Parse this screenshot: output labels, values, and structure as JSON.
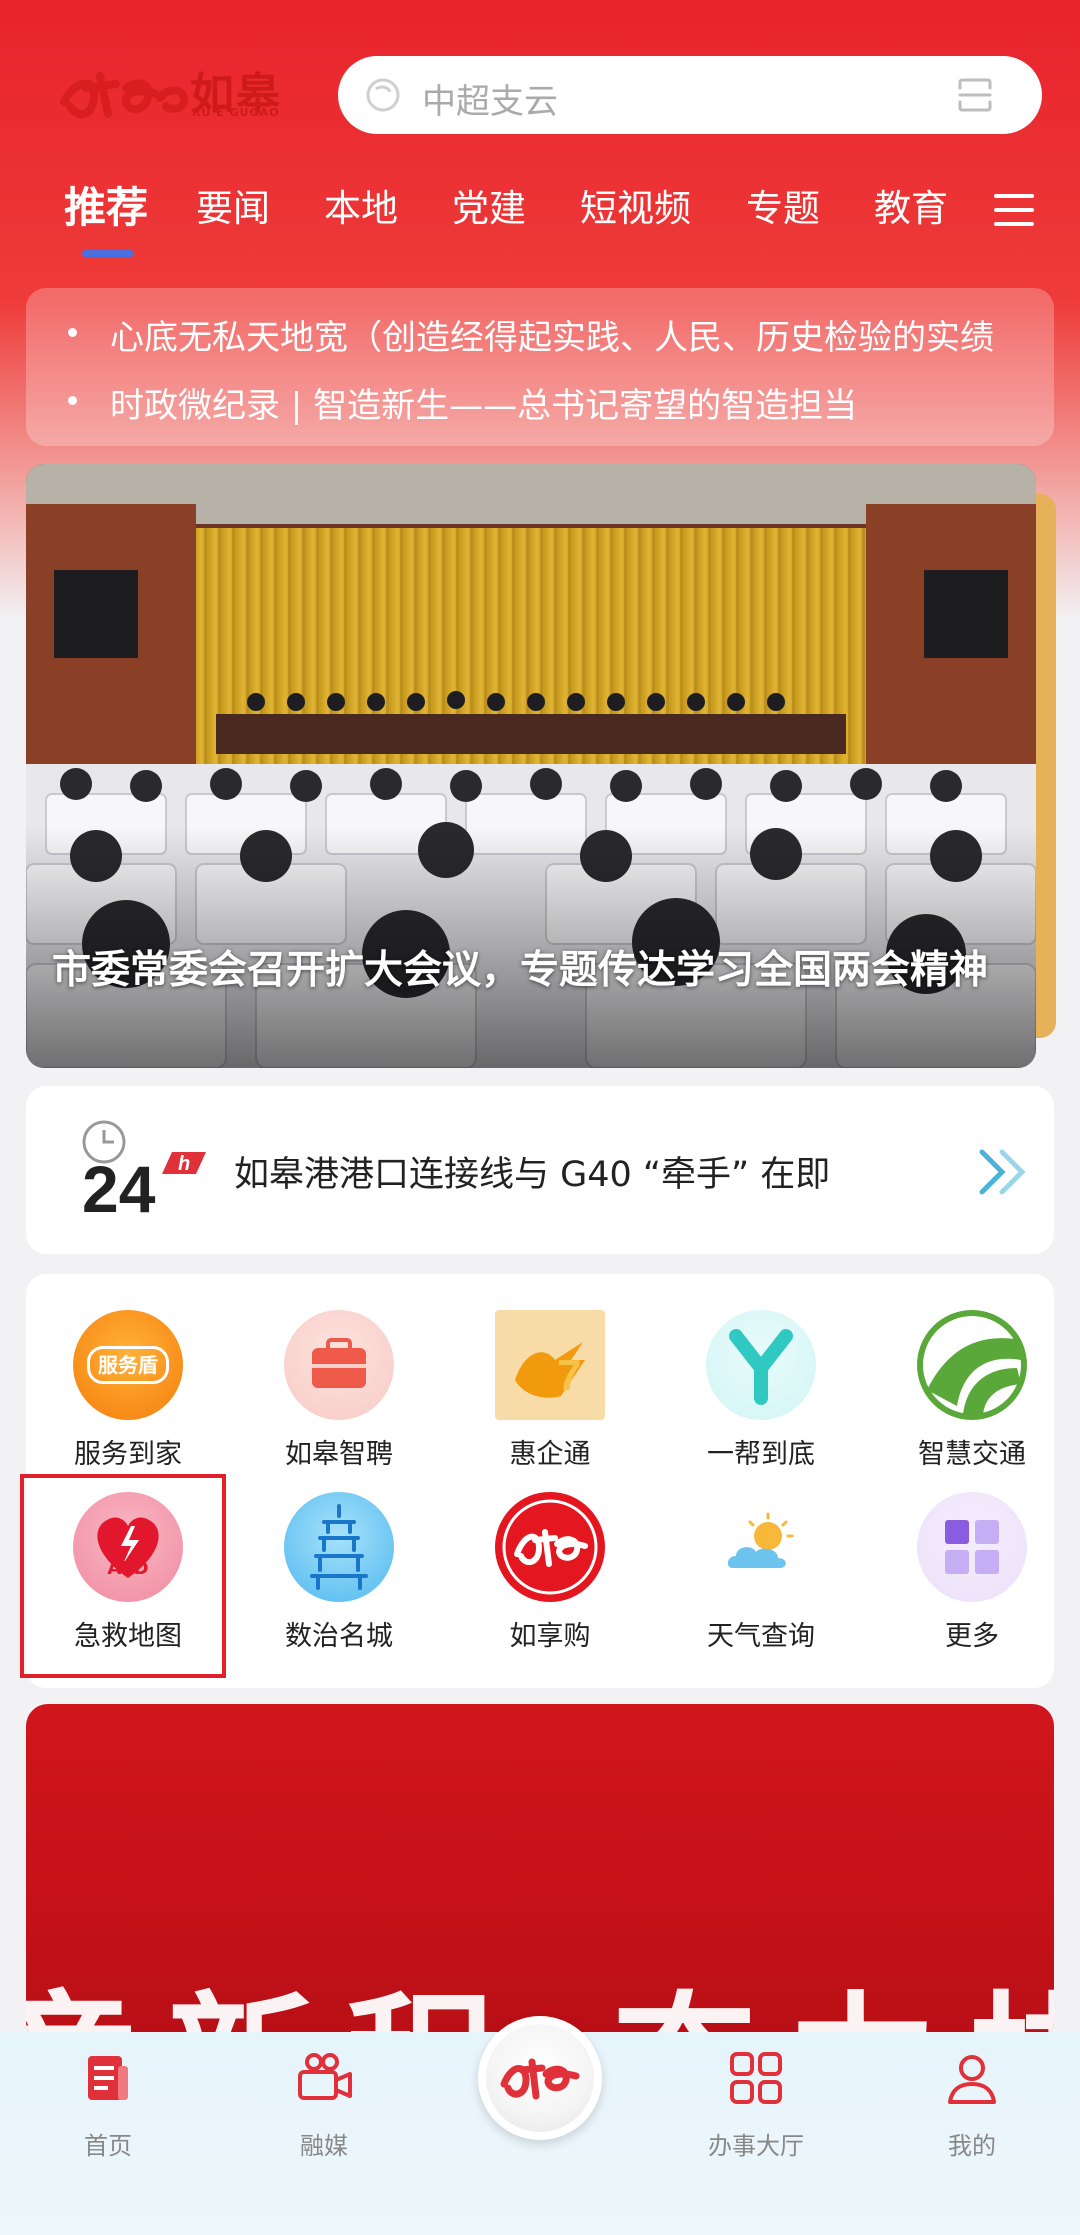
{
  "header": {
    "logo_text": "如皋",
    "logo_sub": "RU E GUGAO",
    "search_placeholder": "中超支云"
  },
  "tabs": [
    {
      "label": "推荐",
      "active": true
    },
    {
      "label": "要闻"
    },
    {
      "label": "本地"
    },
    {
      "label": "党建"
    },
    {
      "label": "短视频"
    },
    {
      "label": "专题"
    },
    {
      "label": "教育"
    }
  ],
  "ticker": [
    "心底无私天地宽（创造经得起实践、人民、历史检验的实绩",
    "时政微纪录 | 智造新生——总书记寄望的智造担当"
  ],
  "banner": {
    "title": "市委常委会召开扩大会议，专题传达学习全国两会精神"
  },
  "news_strip": {
    "badge_number": "24",
    "badge_unit": "h",
    "headline": "如皋港港口连接线与 G40 “牵手” 在即"
  },
  "services": [
    {
      "label": "服务到家",
      "icon": "service-shield-icon",
      "badge": "服务盾"
    },
    {
      "label": "如皋智聘",
      "icon": "briefcase-icon"
    },
    {
      "label": "惠企通",
      "icon": "hand-seven-icon"
    },
    {
      "label": "一帮到底",
      "icon": "y-letter-icon"
    },
    {
      "label": "智慧交通",
      "icon": "road-icon"
    },
    {
      "label": "急救地图",
      "icon": "aed-heart-icon",
      "badge": "AED"
    },
    {
      "label": "数治名城",
      "icon": "pagoda-icon"
    },
    {
      "label": "如享购",
      "icon": "shopping-logo-icon"
    },
    {
      "label": "天气查询",
      "icon": "weather-icon"
    },
    {
      "label": "更多",
      "icon": "grid-more-icon"
    }
  ],
  "promo": {
    "text": "章新程 奋力排"
  },
  "bottom_nav": [
    {
      "label": "首页",
      "icon": "home-doc-icon"
    },
    {
      "label": "融媒",
      "icon": "video-camera-icon"
    },
    {
      "label": "",
      "icon": "center-logo-icon"
    },
    {
      "label": "办事大厅",
      "icon": "apps-grid-icon"
    },
    {
      "label": "我的",
      "icon": "user-icon"
    }
  ],
  "colors": {
    "brand_red": "#e8232c",
    "tab_indicator": "#4a6fe0",
    "nav_icon_red": "#e0303a"
  }
}
